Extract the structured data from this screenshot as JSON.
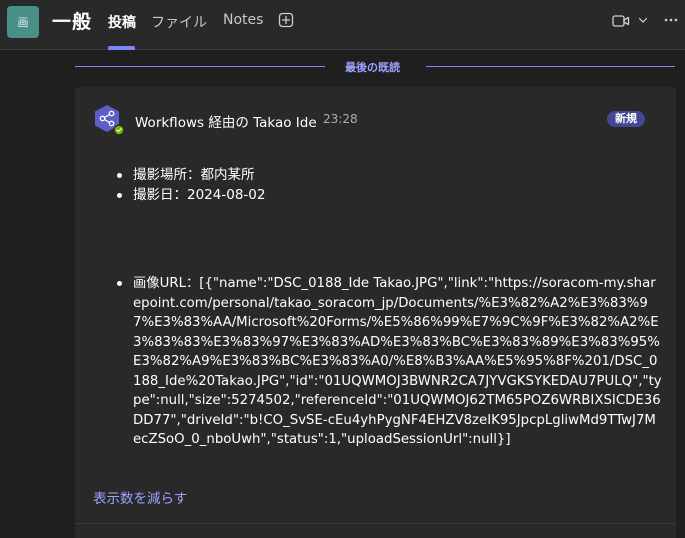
{
  "header": {
    "team_avatar_glyph": "画",
    "channel_name": "一般",
    "tabs": [
      {
        "label": "投稿",
        "active": true
      },
      {
        "label": "ファイル",
        "active": false
      },
      {
        "label": "Notes",
        "active": false
      }
    ],
    "icons": {
      "add_tab": "plus-square-icon",
      "video": "video-camera-icon",
      "chevron": "chevron-down-icon",
      "more": "more-horizontal-icon"
    }
  },
  "divider": {
    "label": "最後の既読"
  },
  "message": {
    "sender": "Workflows 経由の Takao Ide",
    "time": "23:28",
    "badge": "新規",
    "bot_icon": "workflows-share-icon",
    "properties": [
      "撮影場所：都内某所",
      "撮影日：2024-08-02"
    ],
    "image_url": "画像URL：[{\"name\":\"DSC_0188_Ide Takao.JPG\",\"link\":\"https://soracom-my.sharepoint.com/personal/takao_soracom_jp/Documents/%E3%82%A2%E3%83%97%E3%83%AA/Microsoft%20Forms/%E5%86%99%E7%9C%9F%E3%82%A2%E3%83%83%E3%83%97%E3%83%AD%E3%83%BC%E3%83%89%E3%83%95%E3%82%A9%E3%83%BC%E3%83%A0/%E8%B3%AA%E5%95%8F%201/DSC_0188_Ide%20Takao.JPG\",\"id\":\"01UQWMOJ3BWNR2CA7JYVGKSYKEDAU7PULQ\",\"type\":null,\"size\":5274502,\"referenceId\":\"01UQWMOJ62TM65POZ6WRBIXSICDE36DD77\",\"driveId\":\"b!CO_SvSE-cEu4yhPygNF4EHZV8zeIK95JpcpLgliwMd9TTwJ7MecZSoO_0_nboUwh\",\"status\":1,\"uploadSessionUrl\":null}]",
    "show_less": "表示数を減らす"
  },
  "colors": {
    "accent": "#7f85f5",
    "badge": "#444791",
    "link": "#9ea2ff",
    "team_avatar": "#4a8f87"
  }
}
